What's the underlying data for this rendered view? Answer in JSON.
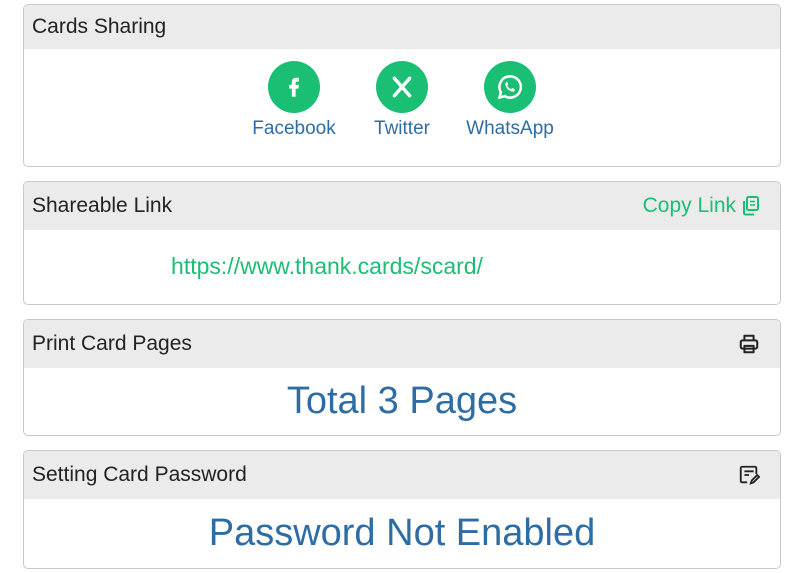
{
  "sharing": {
    "title": "Cards Sharing",
    "items": [
      {
        "label": "Facebook",
        "icon": "facebook-icon"
      },
      {
        "label": "Twitter",
        "icon": "x-twitter-icon"
      },
      {
        "label": "WhatsApp",
        "icon": "whatsapp-icon"
      }
    ],
    "accent_color": "#1bbf73"
  },
  "link": {
    "title": "Shareable Link",
    "copy_label": "Copy Link",
    "url": "https://www.thank.cards/scard/"
  },
  "print": {
    "title": "Print Card Pages",
    "total_pages": "Total 3 Pages",
    "icon": "printer-icon"
  },
  "password": {
    "title": "Setting Card Password",
    "status": "Password Not Enabled",
    "icon": "edit-password-icon"
  }
}
